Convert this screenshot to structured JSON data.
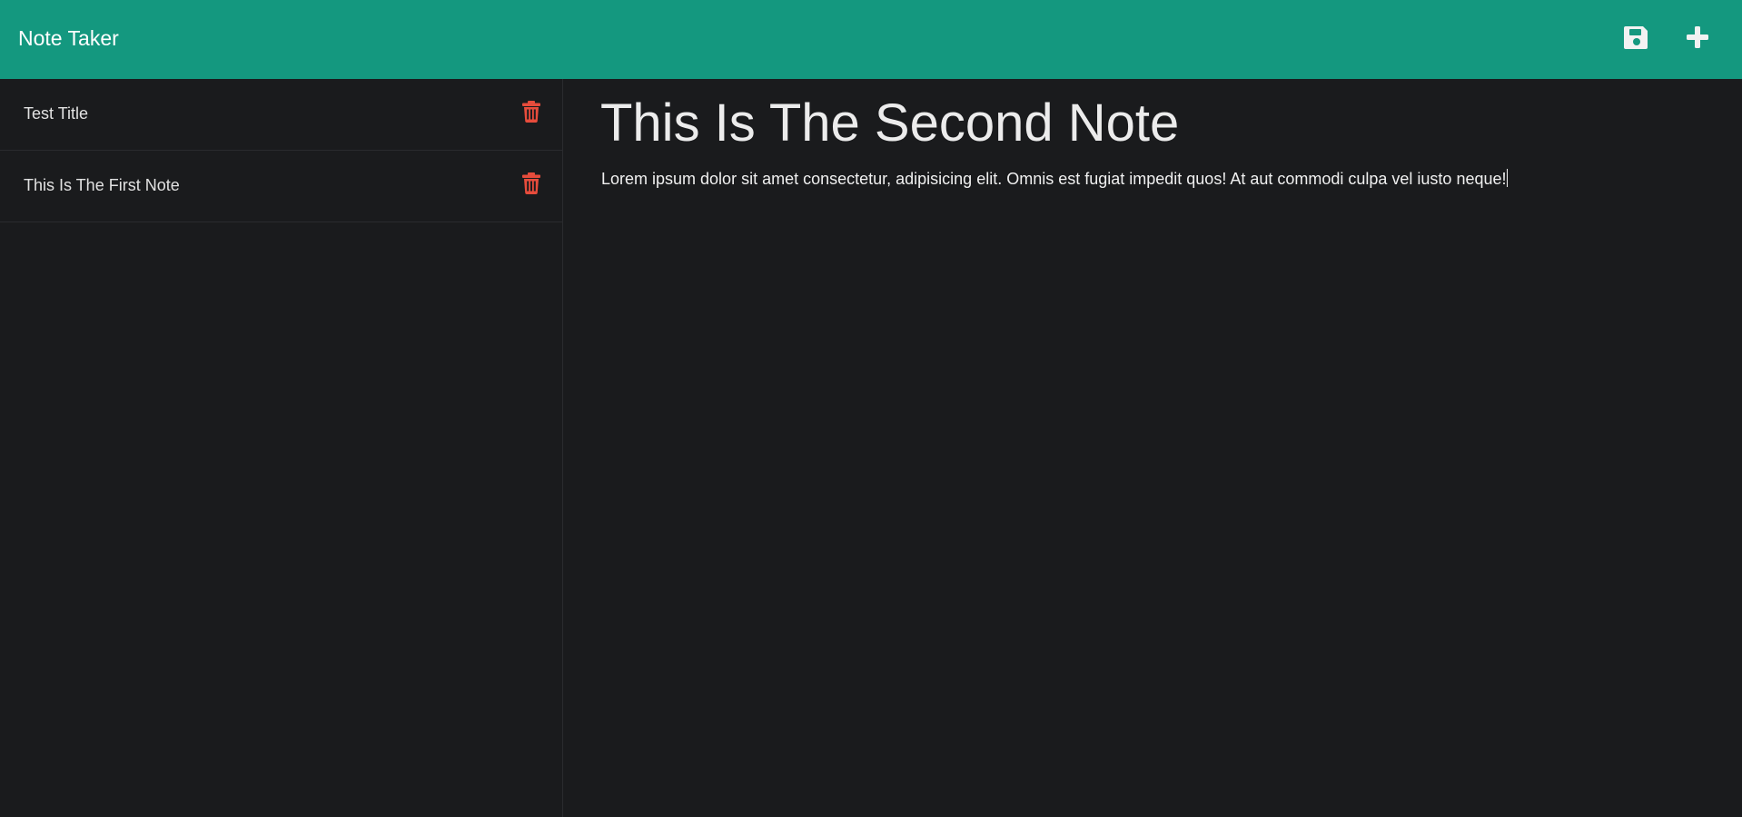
{
  "app": {
    "title": "Note Taker"
  },
  "toolbar": {
    "save_icon": "floppy-disk-icon",
    "add_icon": "plus-icon"
  },
  "sidebar": {
    "notes": [
      {
        "title": "Test Title",
        "delete_icon": "trash-icon"
      },
      {
        "title": "This Is The First Note",
        "delete_icon": "trash-icon"
      }
    ]
  },
  "editor": {
    "title": "This Is The Second Note",
    "body": "Lorem ipsum dolor sit amet consectetur, adipisicing elit. Omnis est fugiat impedit quos! At aut commodi culpa vel iusto neque!"
  },
  "colors": {
    "navbar": "#14987f",
    "background": "#1a1b1d",
    "delete_icon": "#e74c3c",
    "nav_icons": "#f2f2f2"
  }
}
